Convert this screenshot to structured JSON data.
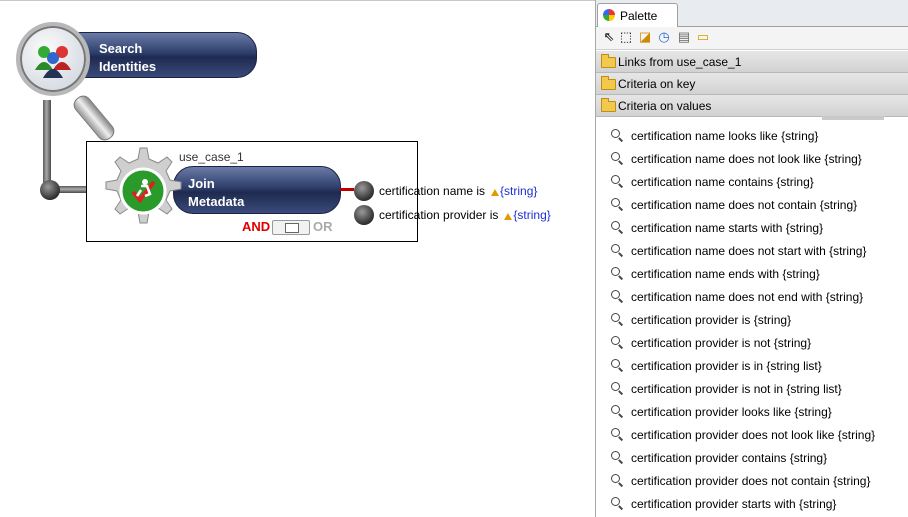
{
  "canvas": {
    "search_node": {
      "label_line1": "Search",
      "label_line2": "Identities"
    },
    "join_node": {
      "title": "use_case_1",
      "label_line1": "Join",
      "label_line2": "Metadata",
      "and_label": "AND",
      "or_label": "OR",
      "criteria": [
        {
          "text": "certification name is",
          "value": "{string}"
        },
        {
          "text": "certification provider is",
          "value": "{string}"
        }
      ]
    }
  },
  "palette": {
    "tab_label": "Palette",
    "tools": [
      "select-tool-icon",
      "marquee-tool-icon",
      "link-tool-icon",
      "clock-tool-icon",
      "calculator-tool-icon",
      "note-tool-icon"
    ],
    "drawers": [
      "Links from use_case_1",
      "Criteria on key",
      "Criteria on values"
    ],
    "items": [
      "certification name looks like {string}",
      "certification name does not look like {string}",
      "certification name contains {string}",
      "certification name does not contain {string}",
      "certification name starts with {string}",
      "certification name does not start with {string}",
      "certification name ends with {string}",
      "certification name does not end with {string}",
      "certification provider is {string}",
      "certification provider is not {string}",
      "certification provider is in {string list}",
      "certification provider is not in {string list}",
      "certification provider looks like {string}",
      "certification provider does not look like {string}",
      "certification provider contains {string}",
      "certification provider does not contain {string}",
      "certification provider starts with {string}"
    ]
  }
}
